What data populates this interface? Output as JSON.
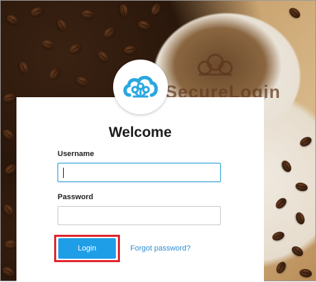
{
  "background": {
    "brand_text": "SecureLogin"
  },
  "login": {
    "title": "Welcome",
    "username_label": "Username",
    "username_value": "",
    "password_label": "Password",
    "password_value": "",
    "login_button": "Login",
    "forgot_link": "Forgot password?"
  },
  "colors": {
    "accent": "#1f9ee8",
    "link": "#2d8ed1",
    "highlight": "#e0242f",
    "logo": "#2aa7e0"
  },
  "icons": {
    "logo": "cloud-network-icon"
  }
}
